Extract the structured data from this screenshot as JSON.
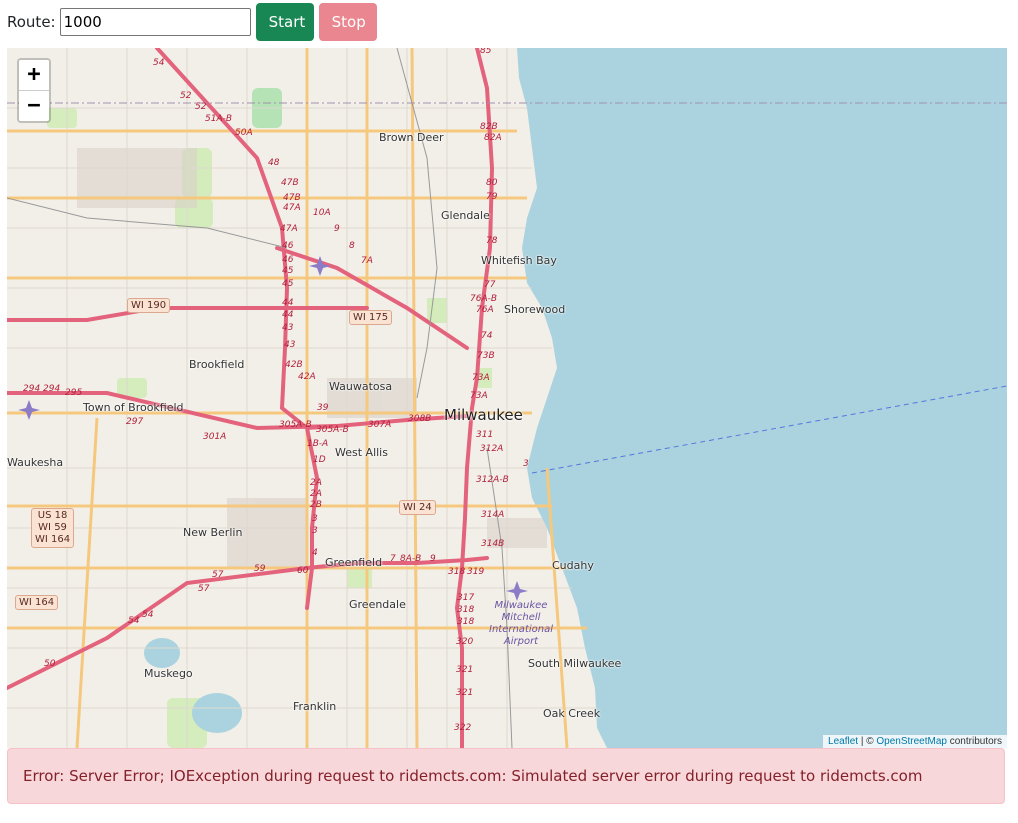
{
  "route": {
    "label": "Route:",
    "value": "1000"
  },
  "buttons": {
    "start": "Start",
    "stop": "Stop"
  },
  "colors": {
    "start": "#198754",
    "stop": "#ea868f",
    "water": "#aad3df",
    "land": "#f2efe9",
    "motorway": "#e4637c",
    "major_road": "#f6c87e"
  },
  "map": {
    "zoom_in": "+",
    "zoom_out": "−",
    "attribution": {
      "leaflet": "Leaflet",
      "separator": " | © ",
      "osm": "OpenStreetMap",
      "contributors": " contributors"
    },
    "places": {
      "milwaukee": "Milwaukee",
      "brown_deer": "Brown Deer",
      "glendale": "Glendale",
      "whitefish_bay": "Whitefish Bay",
      "shorewood": "Shorewood",
      "brookfield": "Brookfield",
      "town_of_brookfield": "Town of Brookfield",
      "wauwatosa": "Wauwatosa",
      "west_allis": "West Allis",
      "waukesha": "Waukesha",
      "new_berlin": "New Berlin",
      "greenfield": "Greenfield",
      "greendale": "Greendale",
      "cudahy": "Cudahy",
      "south_milwaukee": "South Milwaukee",
      "muskego": "Muskego",
      "franklin": "Franklin",
      "oak_creek": "Oak Creek",
      "airport": "Milwaukee Mitchell International Airport"
    },
    "shields": {
      "wi190": "WI 190",
      "wi175": "WI 175",
      "wi24": "WI 24",
      "us18": "US 18",
      "wi59": "WI 59",
      "wi164a": "WI 164",
      "wi164b": "WI 164"
    },
    "exits": {
      "e85": "85",
      "e82b": "82B",
      "e82a": "82A",
      "e80": "80",
      "e79": "79",
      "e78": "78",
      "e77": "77",
      "e76ab": "76A-B",
      "e76a": "76A",
      "e74": "74",
      "e73b": "73B",
      "e73a1": "73A",
      "e73a2": "73A",
      "e311": "311",
      "e312a": "312A",
      "e312ab": "312A-B",
      "e314a": "314A",
      "e314b": "314B",
      "e318": "318",
      "e319": "319",
      "e317": "317",
      "e318b": "318",
      "e318c": "318",
      "e320": "320",
      "e321a": "321",
      "e321b": "321",
      "e322": "322",
      "e308b": "308B",
      "e307a": "307A",
      "e305ab": "305A-B",
      "e305ab2": "305A-B",
      "e301a": "301A",
      "e297": "297",
      "e295": "295",
      "e294a": "294",
      "e294b": "294",
      "e54": "54",
      "e52a": "52",
      "e52b": "52",
      "e51ab": "51A-B",
      "e50a": "50A",
      "e48": "48",
      "e47b1": "47B",
      "e47b2": "47B",
      "e47a1": "47A",
      "e47a2": "47A",
      "e46a": "46",
      "e46b": "46",
      "e45a": "45",
      "e45b": "45",
      "e44a": "44",
      "e44b": "44",
      "e43a": "43",
      "e43b": "43",
      "e42b": "42B",
      "e42a": "42A",
      "e39": "39",
      "e1ba": "1B-A",
      "e1d": "1D",
      "e2a1": "2A",
      "e2a2": "2A",
      "e2b": "2B",
      "e3a": "3",
      "e3b": "3",
      "e4": "4",
      "e60": "60",
      "e59": "59",
      "e57a": "57",
      "e57b": "57",
      "e54b": "54",
      "e54c": "54",
      "e50": "50",
      "e10a": "10A",
      "e9": "9",
      "e8": "8",
      "e7a": "7A",
      "e78b": "7",
      "e8ab": "8A-B",
      "e9b": "9",
      "e3": "3",
      "e7": "7"
    }
  },
  "error": {
    "message": "Error: Server Error; IOException during request to ridemcts.com: Simulated server error during request to ridemcts.com"
  }
}
